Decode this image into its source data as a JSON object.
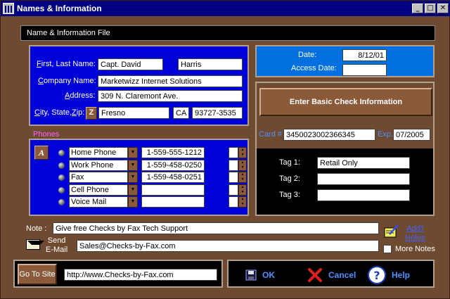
{
  "window": {
    "title": "Names & Information",
    "controls": [
      "_",
      "□",
      "✕"
    ]
  },
  "header": {
    "title": "Name & Information File"
  },
  "name_panel": {
    "first_last_label_u": "F",
    "first_last_label": "irst, Last Name:",
    "first_name": "Capt. David",
    "last_name": "Harris",
    "company_label_u": "C",
    "company_label": "ompany Name:",
    "company": "Marketwizz Internet Solutions",
    "address_label_u": "A",
    "address_label": "ddress:",
    "address": "309 N. Claremont Ave.",
    "csz_label_u": "C",
    "csz_label": "ity, State,",
    "csz_label_z": "Z",
    "csz_label_end": "ip:",
    "zip_button": "Z",
    "city": "Fresno",
    "state": "CA",
    "zip": "93727-3535"
  },
  "phones": {
    "label": "Phones",
    "a_button": "A",
    "rows": [
      {
        "type": "Home Phone",
        "number": "1-559-555-1212"
      },
      {
        "type": "Work Phone",
        "number": "1-559-458-0250"
      },
      {
        "type": "Fax",
        "number": "1-559-458-0251"
      },
      {
        "type": "Cell Phone",
        "number": ""
      },
      {
        "type": "Voice Mail",
        "number": ""
      }
    ]
  },
  "dates": {
    "date_label": "Date:",
    "date": "8/12/01",
    "access_label": "Access Date:",
    "access": ""
  },
  "check": {
    "button": "Enter Basic Check Information",
    "card_label": "Card #",
    "card": "3450023002366345",
    "exp_label": "Exp.",
    "exp": "07/2005",
    "tag1_label": "Tag 1:",
    "tag1": "Retail Only",
    "tag2_label": "Tag 2:",
    "tag2": "",
    "tag3_label": "Tag 3:",
    "tag3": ""
  },
  "note": {
    "label": "Note :",
    "value": "Give free Checks by Fax Tech Support",
    "add_notes_1": "Add'l",
    "add_notes_2": "Notes",
    "more_notes": "More Notes"
  },
  "email": {
    "label_1": "Send",
    "label_2": "E-Mail",
    "value": "Sales@Checks-by-Fax.com"
  },
  "site": {
    "button": "Go To Site",
    "url": "http://www.Checks-by-Fax.com"
  },
  "actions": {
    "ok": "OK",
    "cancel": "Cancel",
    "help": "Help"
  },
  "colors": {
    "accent": "#0000d8",
    "link": "#5090ff",
    "phones_label": "#ff60ff"
  }
}
